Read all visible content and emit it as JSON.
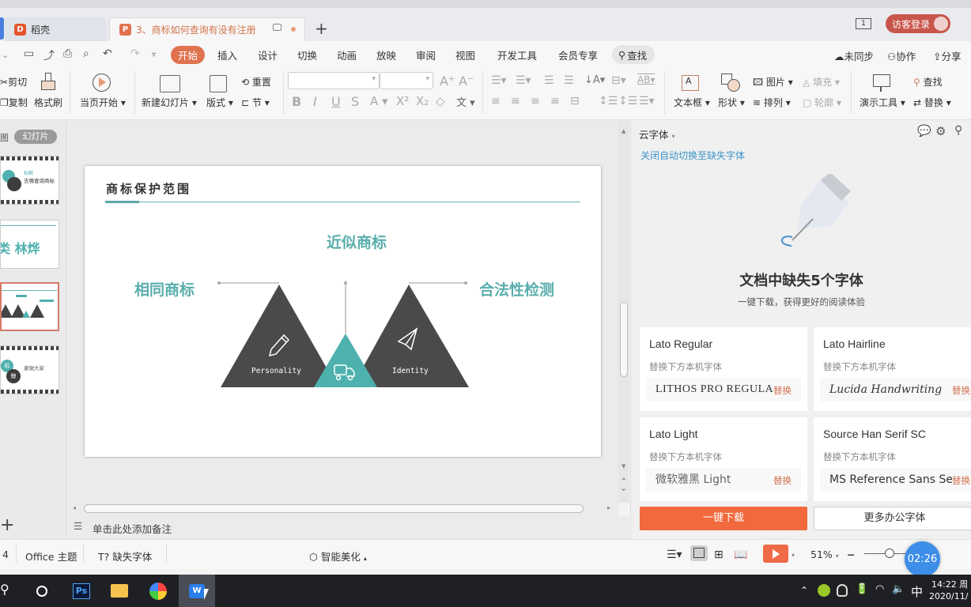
{
  "tabs": [
    {
      "label": "稻壳",
      "icon": "docer-icon",
      "active": false
    },
    {
      "label": "3、商标如何查询有没有注册",
      "icon": "presentation-file-icon",
      "active": true
    }
  ],
  "titlebar": {
    "window_count": "1",
    "login_label": "访客登录"
  },
  "menu": {
    "items": [
      "开始",
      "插入",
      "设计",
      "切换",
      "动画",
      "放映",
      "审阅",
      "视图",
      "开发工具",
      "会员专享"
    ],
    "active": "开始",
    "search_label": "查找",
    "right_actions": [
      "未同步",
      "协作",
      "分享"
    ]
  },
  "ribbon": {
    "cut": "剪切",
    "copy": "复制",
    "format_painter": "格式刷",
    "play_from_current": "当页开始",
    "new_slide": "新建幻灯片",
    "layout": "版式",
    "reset": "重置",
    "section": "节",
    "font_name": "",
    "font_size": "",
    "text_box": "文本框",
    "shape": "形状",
    "picture": "图片",
    "fill": "填充",
    "arrange": "排列",
    "outline": "轮廓",
    "presentation_tools": "演示工具",
    "find": "查找",
    "replace": "替换"
  },
  "thumbs": {
    "view_label": "幻灯片",
    "slides": [
      {
        "title": "去哪查询商标",
        "subtitle": "标鲸"
      },
      {
        "title": "类 林烨"
      },
      {
        "title": "商标保护范围",
        "selected": true
      },
      {
        "title": "谢谢大家",
        "badge1": "标",
        "badge2": "鲸"
      }
    ]
  },
  "slide": {
    "title": "商标保护范围",
    "labels": {
      "left": "相同商标",
      "center": "近似商标",
      "right": "合法性检测"
    },
    "triangles": [
      {
        "caption": "Personality",
        "icon": "pencil-icon",
        "color": "#4a4a4a"
      },
      {
        "caption": "",
        "icon": "truck-icon",
        "color": "#4fb1ae"
      },
      {
        "caption": "Identity",
        "icon": "paper-plane-icon",
        "color": "#4a4a4a"
      }
    ],
    "accent": "#5aaeac"
  },
  "notes": {
    "placeholder": "单击此处添加备注"
  },
  "panel": {
    "title": "云字体",
    "toggle_link": "关闭自动切换至缺失字体",
    "heading": "文档中缺失5个字体",
    "subheading": "一键下载，获得更好的阅读体验",
    "fonts": [
      {
        "name": "Lato Regular",
        "hint": "替换下方本机字体",
        "sample": "LITHOS PRO REGULAR",
        "action": "替换"
      },
      {
        "name": "Lato Hairline",
        "hint": "替换下方本机字体",
        "sample": "Lucida Handwriting",
        "action": "替换"
      },
      {
        "name": "Lato Light",
        "hint": "替换下方本机字体",
        "sample": "微软雅黑 Light",
        "action": "替换"
      },
      {
        "name": "Source Han Serif SC",
        "hint": "替换下方本机字体",
        "sample": "MS Reference Sans Serif",
        "action": "替换"
      }
    ],
    "download_all": "一键下载",
    "more_fonts": "更多办公字体"
  },
  "statusbar": {
    "slide_num": "4",
    "theme": "Office 主题",
    "missing_fonts": "缺失字体",
    "beautify": "智能美化",
    "zoom": "51%",
    "zoom_level": 0.51,
    "timer": "02:26"
  },
  "taskbar": {
    "apps": [
      "search",
      "cortana",
      "photoshop",
      "file-explorer",
      "browser",
      "wps"
    ],
    "time": "14:22 周",
    "date": "2020/11/",
    "ime": "中"
  },
  "colors": {
    "brand_orange": "#e0724f",
    "teal": "#5aaeac",
    "dark_triangle": "#4a4a4a",
    "download_btn": "#f1693c",
    "timer_blue": "#3d8ee8"
  }
}
